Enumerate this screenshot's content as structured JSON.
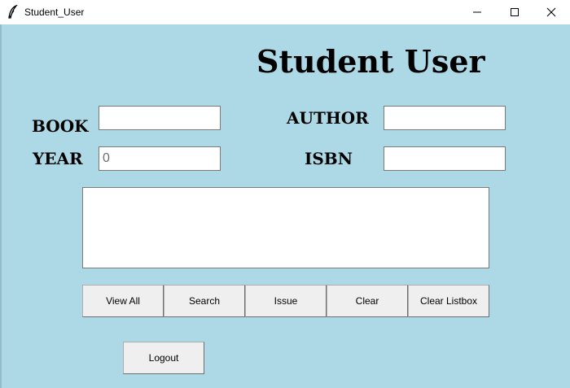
{
  "window": {
    "title": "Student_User",
    "icon": "feather-icon",
    "controls": [
      "minimize-icon",
      "maximize-icon",
      "close-icon"
    ]
  },
  "heading": "Student User",
  "form": {
    "book_label": "BOOK",
    "author_label": "AUTHOR",
    "year_label": "YEAR",
    "isbn_label": "ISBN",
    "book_value": "",
    "author_value": "",
    "year_value": "0",
    "isbn_value": ""
  },
  "listbox": {
    "items": []
  },
  "buttons": {
    "view_all": "View All",
    "search": "Search",
    "issue": "Issue",
    "clear": "Clear",
    "clear_listbox": "Clear Listbox",
    "logout": "Logout"
  },
  "colors": {
    "background": "#add8e6",
    "button_face": "#efefef"
  }
}
